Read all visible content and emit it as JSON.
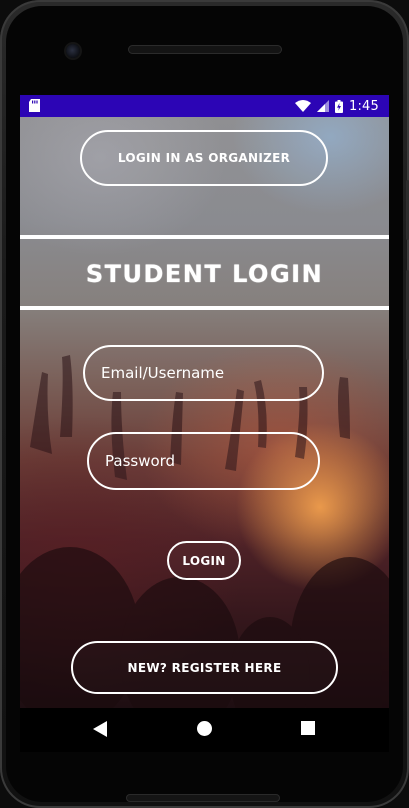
{
  "status_bar": {
    "time": "1:45",
    "icons": [
      "sd-card-icon",
      "wifi-icon",
      "signal-icon",
      "battery-charging-icon"
    ]
  },
  "buttons": {
    "organizer": "LOGIN IN AS ORGANIZER",
    "login": "LOGIN",
    "register": "NEW? REGISTER HERE"
  },
  "header": {
    "title": "STUDENT LOGIN"
  },
  "form": {
    "email_placeholder": "Email/Username",
    "password_placeholder": "Password"
  },
  "nav": {
    "icons": [
      "back-icon",
      "home-icon",
      "recent-apps-icon"
    ]
  },
  "colors": {
    "status_bar": "#2c05b5",
    "outline": "#ffffff"
  }
}
